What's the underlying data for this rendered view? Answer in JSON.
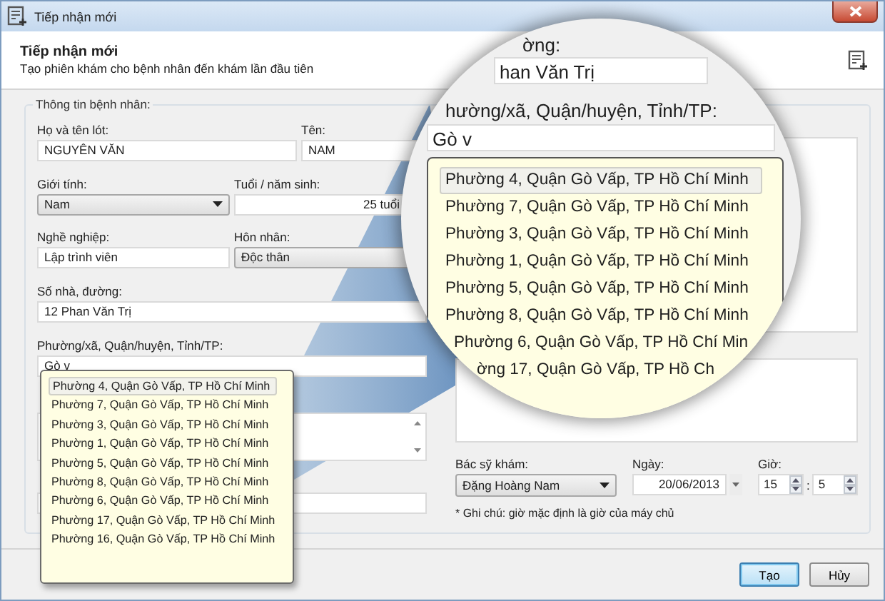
{
  "window": {
    "title": "Tiếp nhận mới"
  },
  "header": {
    "title": "Tiếp nhận mới",
    "subtitle": "Tạo phiên khám cho bệnh nhân đến khám lần đầu tiên"
  },
  "patient_info": {
    "legend": "Thông tin bệnh nhân:",
    "fields": [
      {
        "label": "Họ và tên lót:",
        "value": "NGUYÊN VĂN",
        "kind": "text"
      },
      {
        "label": "Tên:",
        "value": "NAM",
        "kind": "text"
      },
      {
        "label": "Giới tính:",
        "value": "Nam",
        "kind": "combo"
      },
      {
        "label": "Tuổi / năm sinh:",
        "value": "25 tuổi",
        "kind": "number"
      },
      {
        "label": "Nghề nghiệp:",
        "value": "Lập trình viên",
        "kind": "text"
      },
      {
        "label": "Hôn nhân:",
        "value": "Độc thân",
        "kind": "combo"
      },
      {
        "label": "Số nhà, đường:",
        "value": "12 Phan Văn Trị",
        "kind": "text"
      },
      {
        "label": "Phường/xã, Quận/huyện, Tỉnh/TP:",
        "value": "Gò v",
        "kind": "text"
      },
      {
        "kind": "textarea"
      },
      {
        "kind": "text"
      }
    ]
  },
  "autocomplete": {
    "items": [
      {
        "text": "Phường 4, Quận Gò Vấp, TP Hồ Chí Minh",
        "selected": true
      },
      {
        "text": "Phường 7, Quận Gò Vấp, TP Hồ Chí Minh",
        "selected": false
      },
      {
        "text": "Phường 3, Quận Gò Vấp, TP Hồ Chí Minh",
        "selected": false
      },
      {
        "text": "Phường 1, Quận Gò Vấp, TP Hồ Chí Minh",
        "selected": false
      },
      {
        "text": "Phường 5, Quận Gò Vấp, TP Hồ Chí Minh",
        "selected": false
      },
      {
        "text": "Phường 8, Quận Gò Vấp, TP Hồ Chí Minh",
        "selected": false
      },
      {
        "text": "Phường 6, Quận Gò Vấp, TP Hồ Chí Minh",
        "selected": false
      },
      {
        "text": "Phường 17, Quận Gò Vấp, TP Hồ Chí Minh",
        "selected": false
      },
      {
        "text": "Phường 16, Quận Gò Vấp, TP Hồ Chí Minh",
        "selected": false
      }
    ]
  },
  "visit": {
    "doctor": {
      "label": "Bác sỹ khám:",
      "value": "Đặng Hoàng Nam"
    },
    "date": {
      "label": "Ngày:",
      "value": "20/06/2013"
    },
    "time": {
      "label": "Giờ:",
      "hour": "15",
      "separator": ":",
      "minute": "5"
    },
    "note": "* Ghi chú: giờ mặc định là giờ của máy chủ"
  },
  "magnifier": {
    "street_label": "ờng:",
    "street_value": "han Văn Trị",
    "ward_label": "hường/xã, Quận/huyện, Tỉnh/TP:",
    "ward_value": "Gò v",
    "items": [
      {
        "text": "Phường 4, Quận Gò Vấp, TP Hồ Chí Minh",
        "selected": true
      },
      {
        "text": "Phường 7, Quận Gò Vấp, TP Hồ Chí Minh",
        "selected": false
      },
      {
        "text": "Phường 3, Quận Gò Vấp, TP Hồ Chí Minh",
        "selected": false
      },
      {
        "text": "Phường 1, Quận Gò Vấp, TP Hồ Chí Minh",
        "selected": false
      },
      {
        "text": "Phường 5, Quận Gò Vấp, TP Hồ Chí Minh",
        "selected": false
      },
      {
        "text": "Phường 8, Quận Gò Vấp, TP Hồ Chí Minh",
        "selected": false
      },
      {
        "text": "Phường 6, Quận Gò Vấp, TP Hồ Chí Min",
        "selected": false
      },
      {
        "text": "ờng 17, Quận Gò Vấp, TP Hồ Ch",
        "selected": false
      }
    ]
  },
  "buttons": [
    {
      "label": "Tạo",
      "default": true
    },
    {
      "label": "Hủy",
      "default": false
    }
  ]
}
